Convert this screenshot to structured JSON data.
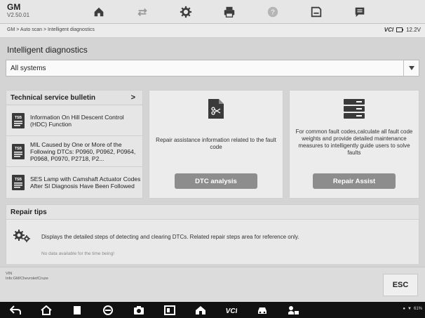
{
  "brand": {
    "make": "GM",
    "version": "V2.50.01"
  },
  "toolbar": {
    "buttons": [
      {
        "name": "home-icon"
      },
      {
        "name": "vehicle-swap-icon"
      },
      {
        "name": "settings-icon"
      },
      {
        "name": "print-icon"
      },
      {
        "name": "help-icon"
      },
      {
        "name": "save-icon"
      },
      {
        "name": "data-log-icon"
      }
    ]
  },
  "breadcrumb": "GM > Auto scan > Intelligent diagnostics",
  "status": {
    "vci": "VCI",
    "battery": "12.2V"
  },
  "page_title": "Intelligent diagnostics",
  "system_select": {
    "value": "All systems"
  },
  "tsb": {
    "title": "Technical service bulletin",
    "chevron": ">",
    "items": [
      {
        "badge": "TSB",
        "text": "Information On Hill Descent Control (HDC) Function"
      },
      {
        "badge": "TSB",
        "text": "MIL Caused by One or More of the Following DTCs: P0960, P0962, P0964, P0968, P0970, P2718, P2..."
      },
      {
        "badge": "TSB",
        "text": "SES Lamp with Camshaft Actuator Codes After SI Diagnosis Have Been Followed"
      }
    ]
  },
  "dtc_panel": {
    "description": "Repair assistance information related to the fault code",
    "button": "DTC analysis"
  },
  "assist_panel": {
    "description": "For common fault codes,calculate all fault code weights and provide detailed maintenance measures to intelligently guide users to solve faults",
    "button": "Repair Assist"
  },
  "repair_tips": {
    "title": "Repair tips",
    "text": "Displays the detailed steps of detecting and clearing DTCs. Related repair steps area for reference only.",
    "empty": "No data available for the time being!"
  },
  "footer": {
    "vin_label": "VIN",
    "vehicle_info": "Info:GM/Chevrolet/Cruze",
    "esc": "ESC"
  },
  "navbar": {
    "status_text": "61%",
    "buttons": [
      "back-icon",
      "home-icon",
      "recent-apps-icon",
      "browser-icon",
      "camera-icon",
      "screen-mirror-icon",
      "maxifix-home-icon",
      "vci-icon",
      "car-icon",
      "car-service-icon"
    ]
  },
  "colors": {
    "button_gray": "#8d8d8d",
    "background": "#d4d4d4",
    "navbar": "#111111"
  }
}
